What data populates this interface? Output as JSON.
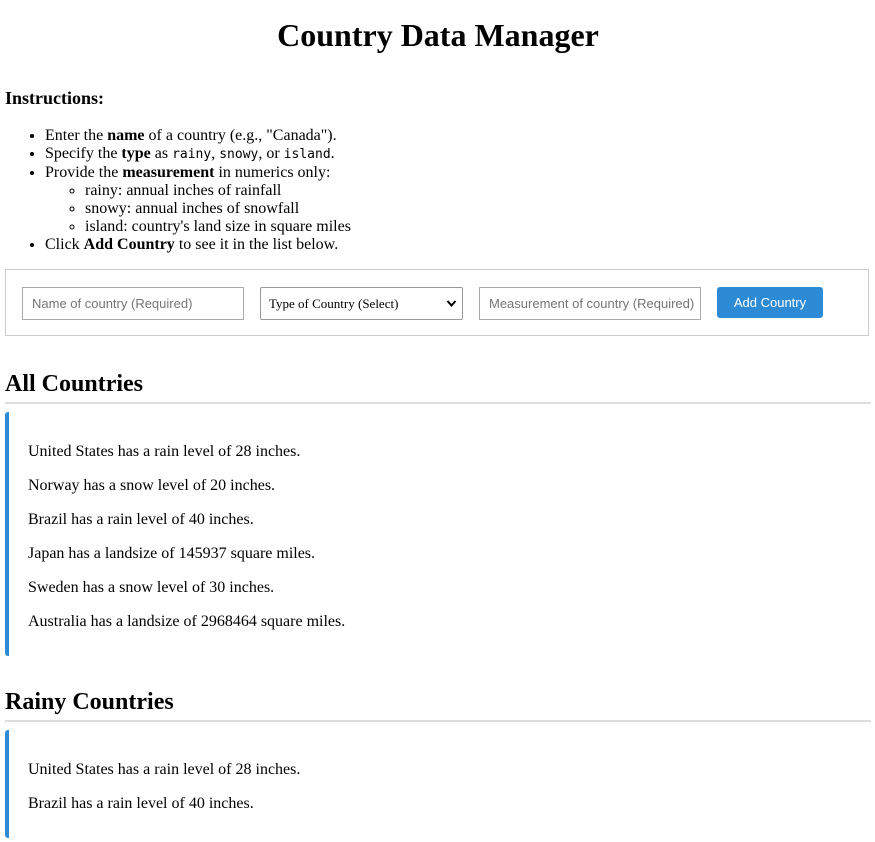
{
  "page": {
    "title": "Country Data Manager"
  },
  "instructions": {
    "heading": "Instructions:",
    "item1": {
      "pre": "Enter the ",
      "bold": "name",
      "post": " of a country (e.g., \"Canada\")."
    },
    "item2": {
      "pre": "Specify the ",
      "bold": "type",
      "mid": " as ",
      "code1": "rainy",
      "sep1": ", ",
      "code2": "snowy",
      "sep2": ", or ",
      "code3": "island",
      "post": "."
    },
    "item3": {
      "pre": "Provide the ",
      "bold": "measurement",
      "post": " in numerics only:"
    },
    "sub_items": [
      "rainy: annual inches of rainfall",
      "snowy: annual inches of snowfall",
      "island: country's land size in square miles"
    ],
    "item4": {
      "pre": "Click ",
      "bold": "Add Country",
      "post": " to see it in the list below."
    }
  },
  "form": {
    "name_placeholder": "Name of country (Required)",
    "type_selected": "Type of Country (Select)",
    "measurement_placeholder": "Measurement of country (Required)",
    "add_button_label": "Add Country"
  },
  "all_countries": {
    "heading": "All Countries",
    "items": [
      "United States has a rain level of 28 inches.",
      "Norway has a snow level of 20 inches.",
      "Brazil has a rain level of 40 inches.",
      "Japan has a landsize of 145937 square miles.",
      "Sweden has a snow level of 30 inches.",
      "Australia has a landsize of 2968464 square miles."
    ]
  },
  "rainy_countries": {
    "heading": "Rainy Countries",
    "items": [
      "United States has a rain level of 28 inches.",
      "Brazil has a rain level of 40 inches."
    ]
  },
  "colors": {
    "accent": "#2d8bd6",
    "divider": "#dddddd",
    "form_border": "#cccccc"
  },
  "icons": {
    "select_arrow": "chevron-down-icon"
  }
}
